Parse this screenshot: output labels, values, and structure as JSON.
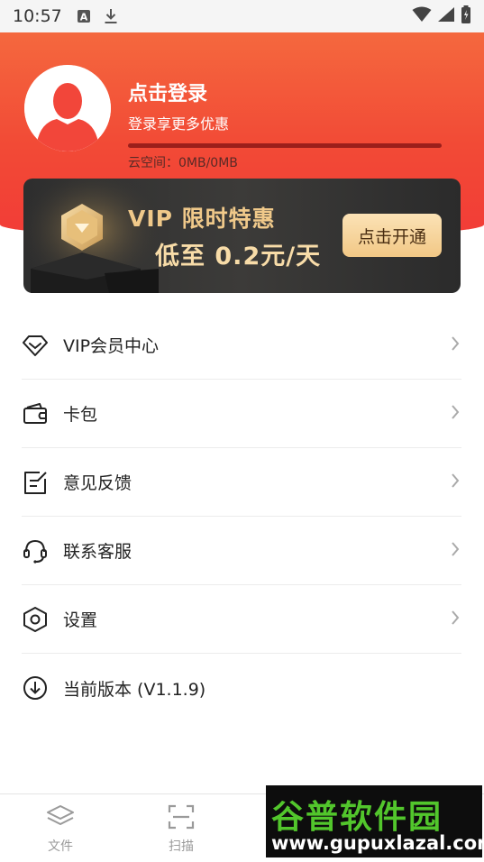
{
  "status_bar": {
    "time": "10:57",
    "icons": [
      "font-a-icon",
      "download-icon",
      "wifi-icon",
      "signal-icon",
      "battery-icon"
    ]
  },
  "profile": {
    "login_title": "点击登录",
    "login_subtitle": "登录享更多优惠",
    "storage_text": "云空间：0MB/0MB",
    "storage_used_fraction": 0
  },
  "vip_banner": {
    "title": "VIP 限时特惠",
    "price_text": "低至 0.2元/天",
    "button_label": "点击开通"
  },
  "menu": {
    "items": [
      {
        "label": "VIP会员中心",
        "icon": "diamond-icon"
      },
      {
        "label": "卡包",
        "icon": "wallet-icon"
      },
      {
        "label": "意见反馈",
        "icon": "feedback-icon"
      },
      {
        "label": "联系客服",
        "icon": "headset-icon"
      },
      {
        "label": "设置",
        "icon": "settings-hexagon-icon"
      },
      {
        "label": "当前版本 (V1.1.9)",
        "icon": "download-circle-icon"
      }
    ]
  },
  "tabbar": {
    "tabs": [
      {
        "label": "文件",
        "icon": "layers-icon"
      },
      {
        "label": "扫描",
        "icon": "scan-icon"
      }
    ]
  },
  "watermark": {
    "main": "谷普软件园",
    "url": "www.gupuxlazal.com"
  },
  "colors": {
    "hero_red": "#f24a36",
    "vip_gold": "#f0c98a",
    "vip_button": "#f7d49c"
  }
}
